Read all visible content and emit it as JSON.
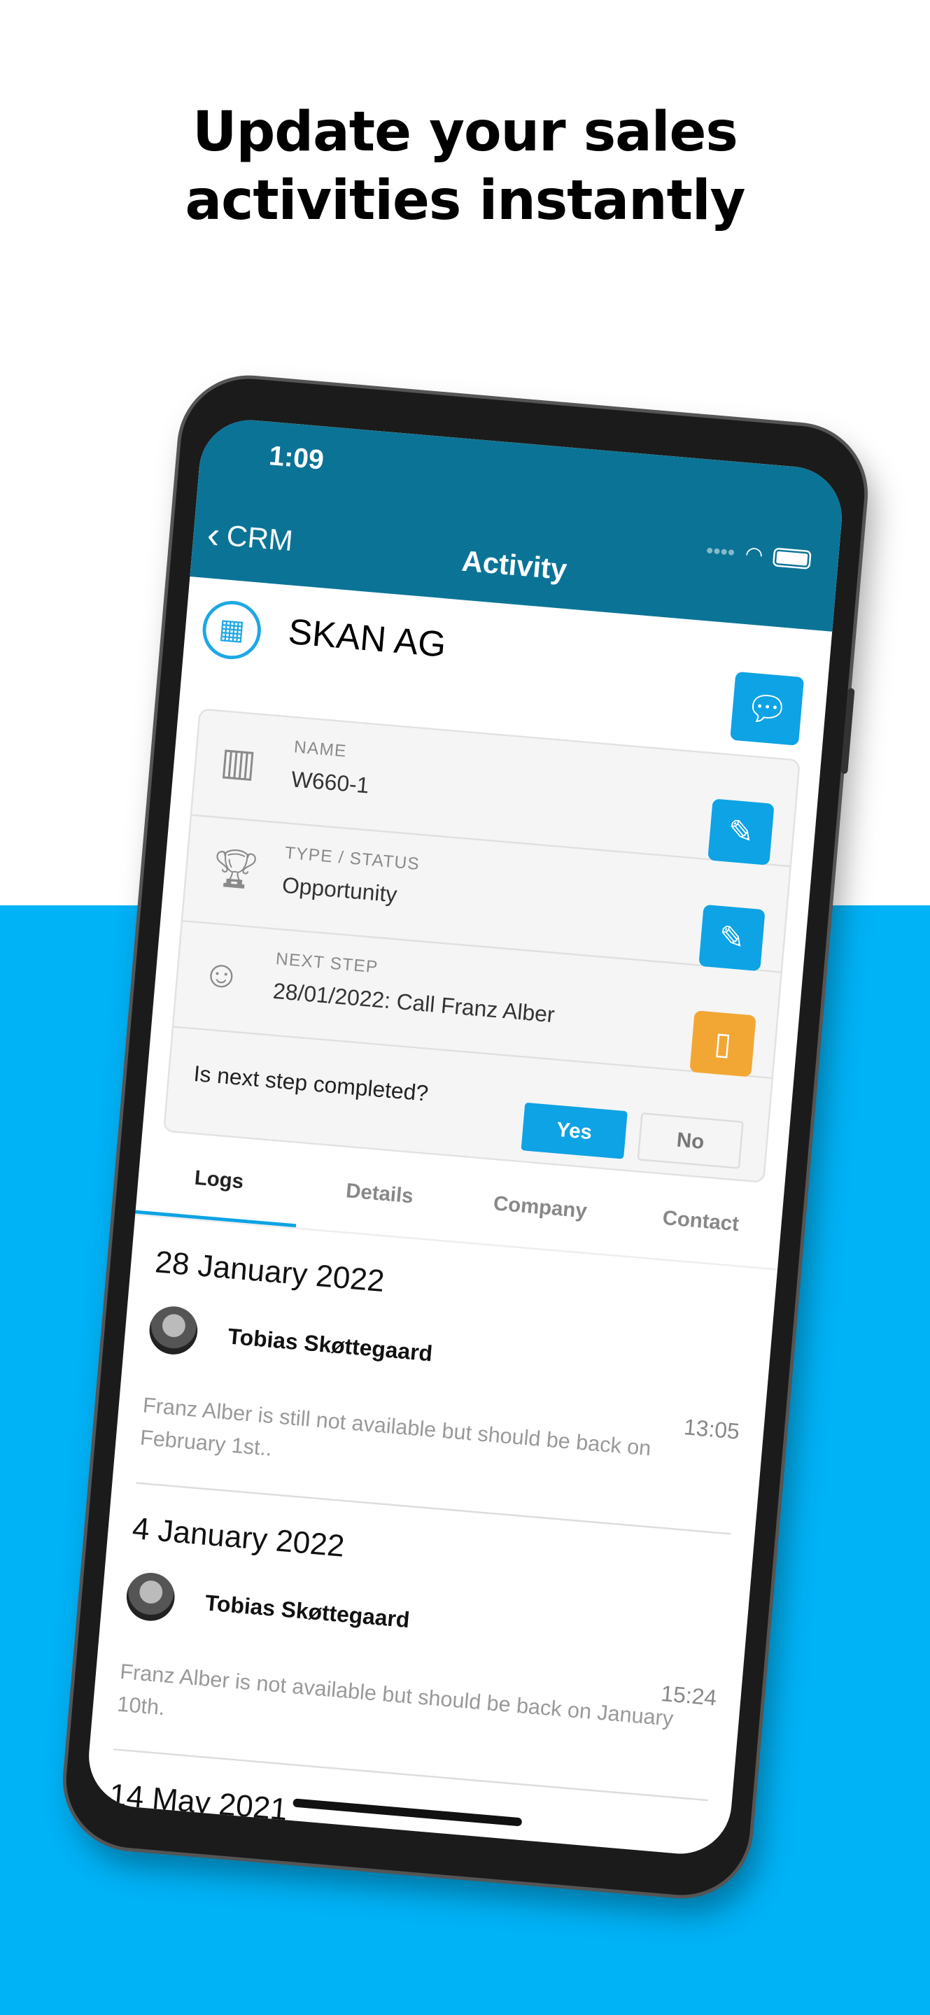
{
  "headline": {
    "line1": "Update your sales",
    "line2": "activities instantly"
  },
  "colors": {
    "background_blue": "#00b2f6",
    "header": "#0b7496",
    "accent": "#0da3e4",
    "orange": "#f2a735"
  },
  "status_bar": {
    "time": "1:09"
  },
  "nav": {
    "back_label": "CRM",
    "title": "Activity"
  },
  "company": {
    "name": "SKAN AG"
  },
  "fields": [
    {
      "label": "NAME",
      "value": "W660-1",
      "icon": "building-icon",
      "action_icon": "pencil-icon"
    },
    {
      "label": "TYPE / STATUS",
      "value": "Opportunity",
      "icon": "trophy-icon",
      "action_icon": "pencil-icon"
    },
    {
      "label": "NEXT STEP",
      "value": "28/01/2022: Call Franz Alber",
      "icon": "headset-icon",
      "action_icon": "phone-icon"
    }
  ],
  "question": {
    "text": "Is next step completed?",
    "yes": "Yes",
    "no": "No",
    "selected": "Yes"
  },
  "tabs": [
    {
      "label": "Logs",
      "active": true
    },
    {
      "label": "Details"
    },
    {
      "label": "Company"
    },
    {
      "label": "Contact"
    }
  ],
  "logs": [
    {
      "date": "28 January 2022",
      "author": "Tobias Skøttegaard",
      "time": "13:05",
      "text": "Franz Alber is still not available but should be back on February 1st.."
    },
    {
      "date": "4 January 2022",
      "author": "Tobias Skøttegaard",
      "time": "15:24",
      "text": "Franz Alber is not available but should be back on January 10th."
    },
    {
      "date": "14 May 2021"
    }
  ]
}
